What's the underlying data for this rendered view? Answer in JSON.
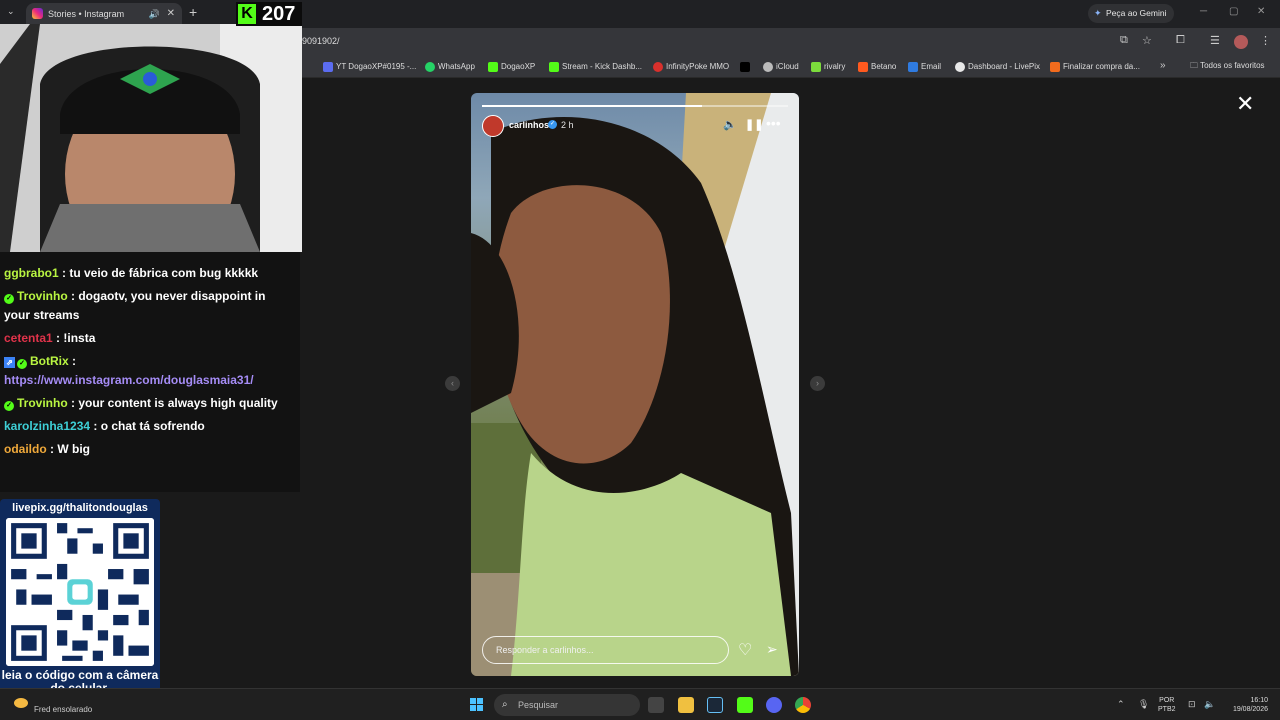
{
  "browser": {
    "tab_title": "Stories • Instagram",
    "new_tab": "+",
    "gemini_label": "Peça ao Gemini",
    "url": "9091902/",
    "bookmarks": [
      {
        "label": "YT DogaoXP#0195 -...",
        "color": "#5b6cf0"
      },
      {
        "label": "WhatsApp",
        "color": "#25d366"
      },
      {
        "label": "DogaoXP",
        "color": "#53fc18"
      },
      {
        "label": "Stream - Kick Dashb...",
        "color": "#53fc18"
      },
      {
        "label": "InfinityPoke MMO",
        "color": "#d9302c"
      },
      {
        "label": "X",
        "color": "#000000"
      },
      {
        "label": "iCloud",
        "color": "#bbbbbb"
      },
      {
        "label": "rivalry",
        "color": "#7cdc3c"
      },
      {
        "label": "Betano",
        "color": "#ff5a1f"
      },
      {
        "label": "Email",
        "color": "#2f7be0"
      },
      {
        "label": "Dashboard - LivePix",
        "color": "#e8e8e8"
      },
      {
        "label": "Finalizar compra da...",
        "color": "#f26b1d"
      }
    ],
    "bookmarks_more": "»",
    "all_bookmarks": "Todos os favoritos"
  },
  "stream_overlay": {
    "viewer_count": "207",
    "chat": [
      {
        "user": "ggbrabo1",
        "user_color": "#b9f542",
        "text": "tu veio de fábrica com bug kkkkk",
        "badge": ""
      },
      {
        "user": "Trovinho",
        "user_color": "#b9f542",
        "text": "dogaotv, you never disappoint in your streams",
        "badge": "green"
      },
      {
        "user": "cetenta1",
        "user_color": "#e0334a",
        "text": "!insta",
        "badge": ""
      },
      {
        "user": "BotRix",
        "user_color": "#b9f542",
        "text": "https://www.instagram.com/douglasmaia31/",
        "badge": "bot"
      },
      {
        "user": "Trovinho",
        "user_color": "#b9f542",
        "text": "your content is always high quality",
        "badge": "green"
      },
      {
        "user": "karolzinha1234",
        "user_color": "#3ecfd6",
        "text": "o chat tá sofrendo",
        "badge": ""
      },
      {
        "user": "odaildo",
        "user_color": "#f0a93a",
        "text": "W big",
        "badge": ""
      }
    ],
    "livepix_url": "livepix.gg/thalitondouglas",
    "livepix_caption": "leia o código com a câmera do celular."
  },
  "story": {
    "username": "carlinhos",
    "time": "2 h",
    "progress": 0.72,
    "reply_placeholder": "Responder a carlinhos...",
    "icons": {
      "mute": "speaker-icon",
      "pause": "pause-icon",
      "more": "more-icon",
      "like": "heart-icon",
      "share": "send-icon"
    }
  },
  "taskbar": {
    "weather": "Fred ensolarado",
    "search_placeholder": "Pesquisar",
    "lang_top": "POR",
    "lang_bottom": "PTB2",
    "time": "16:10",
    "date": "19/08/2026"
  }
}
